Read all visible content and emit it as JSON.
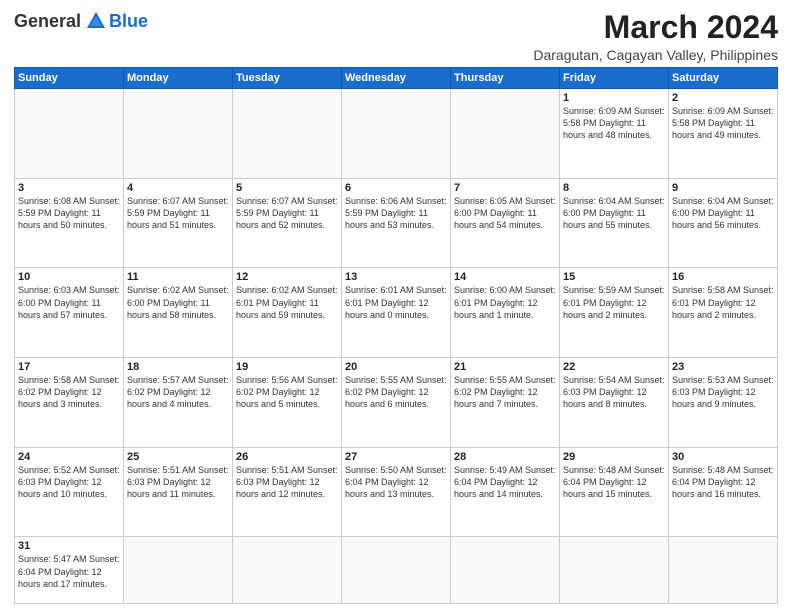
{
  "header": {
    "logo": {
      "general": "General",
      "blue": "Blue"
    },
    "title": "March 2024",
    "location": "Daragutan, Cagayan Valley, Philippines"
  },
  "weekdays": [
    "Sunday",
    "Monday",
    "Tuesday",
    "Wednesday",
    "Thursday",
    "Friday",
    "Saturday"
  ],
  "weeks": [
    [
      {
        "day": "",
        "info": ""
      },
      {
        "day": "",
        "info": ""
      },
      {
        "day": "",
        "info": ""
      },
      {
        "day": "",
        "info": ""
      },
      {
        "day": "",
        "info": ""
      },
      {
        "day": "1",
        "info": "Sunrise: 6:09 AM\nSunset: 5:58 PM\nDaylight: 11 hours and 48 minutes."
      },
      {
        "day": "2",
        "info": "Sunrise: 6:09 AM\nSunset: 5:58 PM\nDaylight: 11 hours and 49 minutes."
      }
    ],
    [
      {
        "day": "3",
        "info": "Sunrise: 6:08 AM\nSunset: 5:59 PM\nDaylight: 11 hours and 50 minutes."
      },
      {
        "day": "4",
        "info": "Sunrise: 6:07 AM\nSunset: 5:59 PM\nDaylight: 11 hours and 51 minutes."
      },
      {
        "day": "5",
        "info": "Sunrise: 6:07 AM\nSunset: 5:59 PM\nDaylight: 11 hours and 52 minutes."
      },
      {
        "day": "6",
        "info": "Sunrise: 6:06 AM\nSunset: 5:59 PM\nDaylight: 11 hours and 53 minutes."
      },
      {
        "day": "7",
        "info": "Sunrise: 6:05 AM\nSunset: 6:00 PM\nDaylight: 11 hours and 54 minutes."
      },
      {
        "day": "8",
        "info": "Sunrise: 6:04 AM\nSunset: 6:00 PM\nDaylight: 11 hours and 55 minutes."
      },
      {
        "day": "9",
        "info": "Sunrise: 6:04 AM\nSunset: 6:00 PM\nDaylight: 11 hours and 56 minutes."
      }
    ],
    [
      {
        "day": "10",
        "info": "Sunrise: 6:03 AM\nSunset: 6:00 PM\nDaylight: 11 hours and 57 minutes."
      },
      {
        "day": "11",
        "info": "Sunrise: 6:02 AM\nSunset: 6:00 PM\nDaylight: 11 hours and 58 minutes."
      },
      {
        "day": "12",
        "info": "Sunrise: 6:02 AM\nSunset: 6:01 PM\nDaylight: 11 hours and 59 minutes."
      },
      {
        "day": "13",
        "info": "Sunrise: 6:01 AM\nSunset: 6:01 PM\nDaylight: 12 hours and 0 minutes."
      },
      {
        "day": "14",
        "info": "Sunrise: 6:00 AM\nSunset: 6:01 PM\nDaylight: 12 hours and 1 minute."
      },
      {
        "day": "15",
        "info": "Sunrise: 5:59 AM\nSunset: 6:01 PM\nDaylight: 12 hours and 2 minutes."
      },
      {
        "day": "16",
        "info": "Sunrise: 5:58 AM\nSunset: 6:01 PM\nDaylight: 12 hours and 2 minutes."
      }
    ],
    [
      {
        "day": "17",
        "info": "Sunrise: 5:58 AM\nSunset: 6:02 PM\nDaylight: 12 hours and 3 minutes."
      },
      {
        "day": "18",
        "info": "Sunrise: 5:57 AM\nSunset: 6:02 PM\nDaylight: 12 hours and 4 minutes."
      },
      {
        "day": "19",
        "info": "Sunrise: 5:56 AM\nSunset: 6:02 PM\nDaylight: 12 hours and 5 minutes."
      },
      {
        "day": "20",
        "info": "Sunrise: 5:55 AM\nSunset: 6:02 PM\nDaylight: 12 hours and 6 minutes."
      },
      {
        "day": "21",
        "info": "Sunrise: 5:55 AM\nSunset: 6:02 PM\nDaylight: 12 hours and 7 minutes."
      },
      {
        "day": "22",
        "info": "Sunrise: 5:54 AM\nSunset: 6:03 PM\nDaylight: 12 hours and 8 minutes."
      },
      {
        "day": "23",
        "info": "Sunrise: 5:53 AM\nSunset: 6:03 PM\nDaylight: 12 hours and 9 minutes."
      }
    ],
    [
      {
        "day": "24",
        "info": "Sunrise: 5:52 AM\nSunset: 6:03 PM\nDaylight: 12 hours and 10 minutes."
      },
      {
        "day": "25",
        "info": "Sunrise: 5:51 AM\nSunset: 6:03 PM\nDaylight: 12 hours and 11 minutes."
      },
      {
        "day": "26",
        "info": "Sunrise: 5:51 AM\nSunset: 6:03 PM\nDaylight: 12 hours and 12 minutes."
      },
      {
        "day": "27",
        "info": "Sunrise: 5:50 AM\nSunset: 6:04 PM\nDaylight: 12 hours and 13 minutes."
      },
      {
        "day": "28",
        "info": "Sunrise: 5:49 AM\nSunset: 6:04 PM\nDaylight: 12 hours and 14 minutes."
      },
      {
        "day": "29",
        "info": "Sunrise: 5:48 AM\nSunset: 6:04 PM\nDaylight: 12 hours and 15 minutes."
      },
      {
        "day": "30",
        "info": "Sunrise: 5:48 AM\nSunset: 6:04 PM\nDaylight: 12 hours and 16 minutes."
      }
    ],
    [
      {
        "day": "31",
        "info": "Sunrise: 5:47 AM\nSunset: 6:04 PM\nDaylight: 12 hours and 17 minutes."
      },
      {
        "day": "",
        "info": ""
      },
      {
        "day": "",
        "info": ""
      },
      {
        "day": "",
        "info": ""
      },
      {
        "day": "",
        "info": ""
      },
      {
        "day": "",
        "info": ""
      },
      {
        "day": "",
        "info": ""
      }
    ]
  ]
}
